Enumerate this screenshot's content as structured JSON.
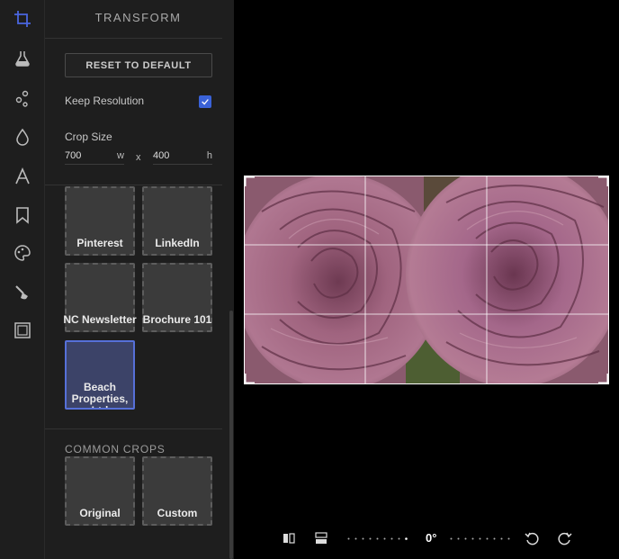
{
  "panel": {
    "title": "TRANSFORM",
    "reset_label": "RESET TO DEFAULT",
    "keep_resolution_label": "Keep Resolution",
    "keep_resolution_checked": true,
    "crop_size_label": "Crop Size",
    "width_value": "700",
    "width_unit": "w",
    "times": "x",
    "height_value": "400",
    "height_unit": "h",
    "presets": [
      {
        "label": "Pinterest"
      },
      {
        "label": "LinkedIn"
      },
      {
        "label": "NC Newsletter"
      },
      {
        "label": "Brochure 101"
      },
      {
        "label": "Beach Properties, Ltd",
        "selected": true
      }
    ],
    "common_crops_title": "COMMON CROPS",
    "common_crops": [
      {
        "label": "Original"
      },
      {
        "label": "Custom"
      }
    ]
  },
  "rail": {
    "icons": [
      "crop-icon",
      "filter-flask-icon",
      "adjust-icon",
      "droplet-icon",
      "text-icon",
      "bookmark-icon",
      "palette-icon",
      "brush-icon",
      "frame-icon"
    ],
    "active": "crop-icon",
    "accent": "#4a66e0"
  },
  "toolbar": {
    "rotation": "0°",
    "icons": [
      "flip-horizontal-icon",
      "flip-vertical-icon",
      "rotate-left-icon",
      "rotate-right-icon"
    ]
  }
}
